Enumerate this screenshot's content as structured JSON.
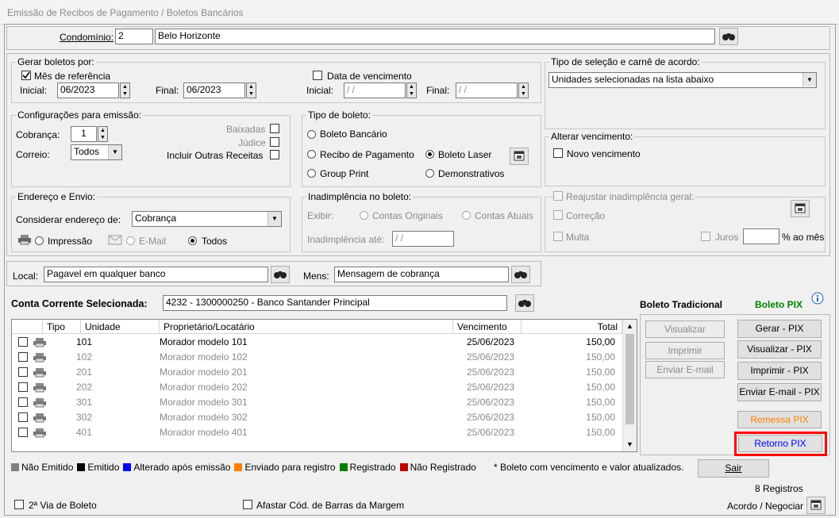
{
  "window": {
    "title": "Emissão de Recibos de Pagamento / Boletos Bancários"
  },
  "condominio": {
    "label": "Condomínio:",
    "code": "2",
    "name": "Belo Horizonte"
  },
  "gerar": {
    "group": "Gerar boletos por:",
    "mes_ref": "Mês de referência",
    "inicial_label": "Inicial:",
    "inicial": "06/2023",
    "final_label": "Final:",
    "final": "06/2023",
    "data_venc": "Data de vencimento",
    "dv_inicial_label": "Inicial:",
    "dv_inicial": "/ /",
    "dv_final_label": "Final:",
    "dv_final": "/ /"
  },
  "tipo_selecao": {
    "group": "Tipo de seleção e carnê de acordo:",
    "value": "Unidades selecionadas na lista abaixo"
  },
  "config": {
    "group": "Configurações para emissão:",
    "cobranca_label": "Cobrança:",
    "cobranca": "1",
    "correio_label": "Correio:",
    "correio": "Todos",
    "baixadas": "Baixadas",
    "judice": "Júdice",
    "outras": "Incluir Outras Receitas"
  },
  "tipo_boleto": {
    "group": "Tipo de boleto:",
    "bancario": "Boleto Bancário",
    "recibo": "Recibo de Pagamento",
    "laser": "Boleto Laser",
    "group_print": "Group Print",
    "demonstrativos": "Demonstrativos"
  },
  "alterar": {
    "group": "Alterar vencimento:",
    "novo": "Novo vencimento"
  },
  "endereco": {
    "group": "Endereço e Envio:",
    "considerar_label": "Considerar endereço de:",
    "considerar": "Cobrança",
    "impressao": "Impressão",
    "email": "E-Mail",
    "todos": "Todos"
  },
  "inadimplencia": {
    "group": "Inadimplência no boleto:",
    "exibir": "Exibir:",
    "originais": "Contas Originais",
    "atuais": "Contas Atuais",
    "ate_label": "Inadimplência até:",
    "ate": "/ /"
  },
  "reajustar": {
    "group": "Reajustar inadimplência geral:",
    "correcao": "Correção",
    "multa": "Multa",
    "juros": "Juros",
    "ao_mes": "% ao mês"
  },
  "local": {
    "label": "Local:",
    "value": "Pagavel em qualquer banco"
  },
  "mens": {
    "label": "Mens:",
    "value": "Mensagem de cobrança"
  },
  "conta": {
    "label": "Conta Corrente Selecionada:",
    "value": "4232 - 1300000250 - Banco Santander Principal"
  },
  "modes": {
    "tradicional": "Boleto Tradicional",
    "pix": "Boleto PIX"
  },
  "table": {
    "headers": [
      "Tipo",
      "Unidade",
      "Proprietário/Locatário",
      "Vencimento",
      "Total"
    ],
    "rows": [
      {
        "unidade": "101",
        "nome": "Morador modelo 101",
        "venc": "25/06/2023",
        "total": "150,00",
        "active": true
      },
      {
        "unidade": "102",
        "nome": "Morador modelo 102",
        "venc": "25/06/2023",
        "total": "150,00",
        "active": false
      },
      {
        "unidade": "201",
        "nome": "Morador modelo 201",
        "venc": "25/06/2023",
        "total": "150,00",
        "active": false
      },
      {
        "unidade": "202",
        "nome": "Morador modelo 202",
        "venc": "25/06/2023",
        "total": "150,00",
        "active": false
      },
      {
        "unidade": "301",
        "nome": "Morador modelo 301",
        "venc": "25/06/2023",
        "total": "150,00",
        "active": false
      },
      {
        "unidade": "302",
        "nome": "Morador modelo 302",
        "venc": "25/06/2023",
        "total": "150,00",
        "active": false
      },
      {
        "unidade": "401",
        "nome": "Morador modelo 401",
        "venc": "25/06/2023",
        "total": "150,00",
        "active": false
      }
    ]
  },
  "buttons": {
    "visualizar": "Visualizar",
    "imprimir": "Imprimir",
    "enviar_email": "Enviar E-mail",
    "gerar_pix": "Gerar - PIX",
    "visualizar_pix": "Visualizar - PIX",
    "imprimir_pix": "Imprimir - PIX",
    "enviar_email_pix": "Enviar E-mail - PIX",
    "remessa_pix": "Remessa PIX",
    "retorno_pix": "Retorno PIX",
    "sair": "Sair"
  },
  "legend": [
    {
      "label": "Não Emitido",
      "color": "#808080"
    },
    {
      "label": "Emitido",
      "color": "#000000"
    },
    {
      "label": "Alterado após emissão",
      "color": "#0000ff"
    },
    {
      "label": "Enviado para registro",
      "color": "#ff8000"
    },
    {
      "label": "Registrado",
      "color": "#008000"
    },
    {
      "label": "Não Registrado",
      "color": "#c00000"
    }
  ],
  "legend_note": "* Boleto com vencimento e valor atualizados.",
  "registros": "8 Registros",
  "segunda_via": "2ª Via de Boleto",
  "afastar": "Afastar Cód. de Barras da Margem",
  "acordo": "Acordo / Negociar",
  "colors": {
    "highlight": "#ff0000",
    "pix": "#008000",
    "remessa": "#ff8000",
    "retorno": "#0000ff"
  }
}
